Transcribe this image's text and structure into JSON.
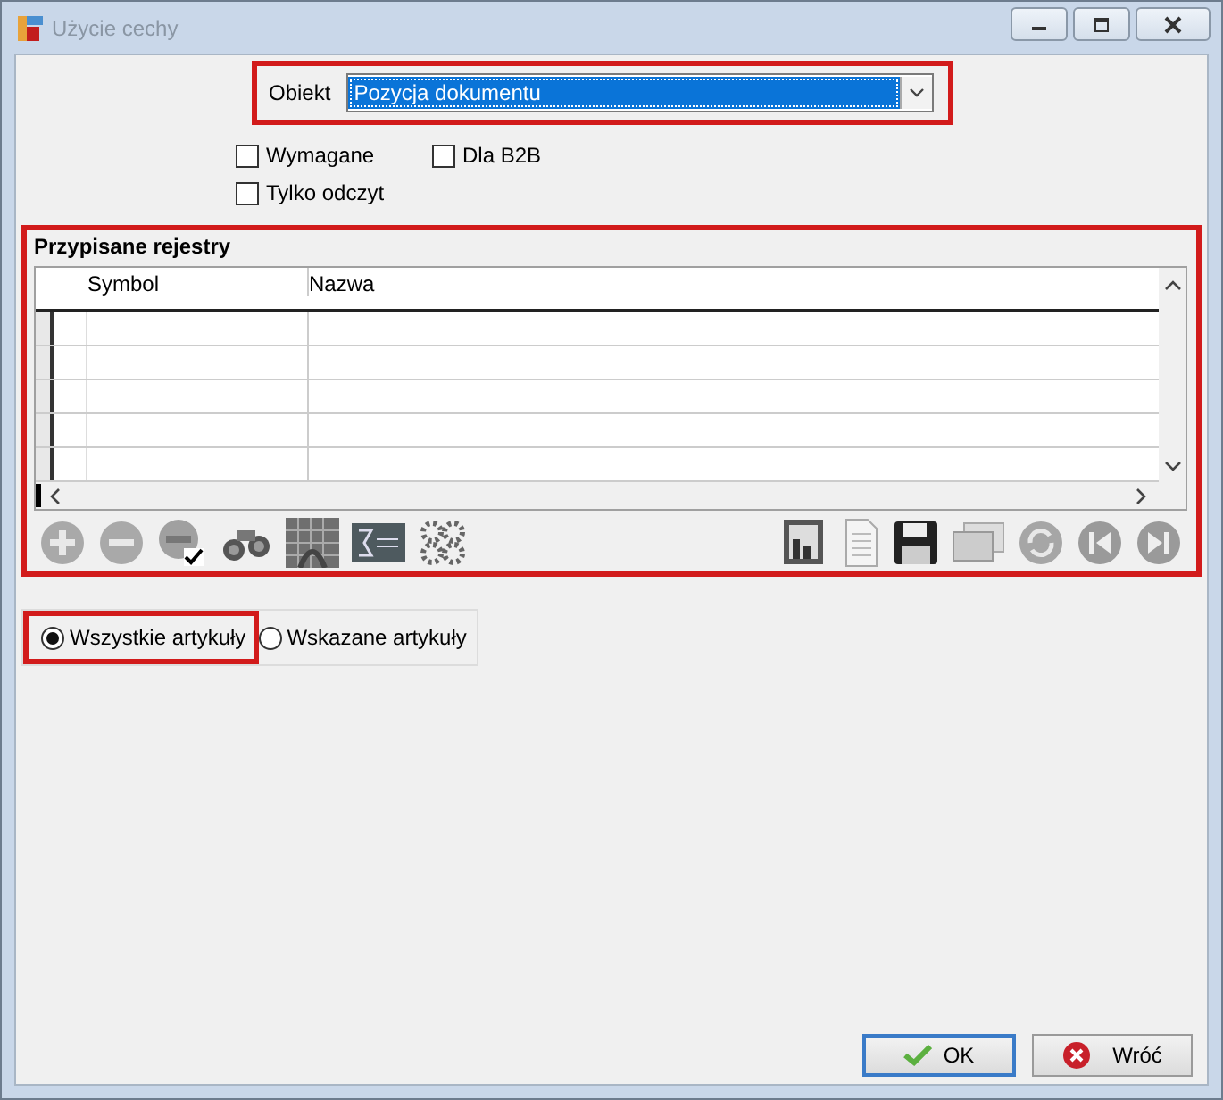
{
  "window": {
    "title": "Użycie cechy"
  },
  "object_field": {
    "label": "Obiekt",
    "value": "Pozycja dokumentu",
    "highlighted": true
  },
  "checkboxes": [
    {
      "label": "Wymagane",
      "checked": false
    },
    {
      "label": "Dla B2B",
      "checked": false
    },
    {
      "label": "Tylko odczyt",
      "checked": false
    }
  ],
  "registers": {
    "title": "Przypisane rejestry",
    "highlighted": true,
    "columns": [
      "Symbol",
      "Nazwa"
    ]
  },
  "article_scope": {
    "highlighted": true,
    "options": [
      {
        "label": "Wszystkie artykuły",
        "selected": true
      },
      {
        "label": "Wskazane artykuły",
        "selected": false
      }
    ]
  },
  "buttons": [
    {
      "label": "OK",
      "kind": "ok"
    },
    {
      "label": "Wróć",
      "kind": "cancel"
    }
  ]
}
